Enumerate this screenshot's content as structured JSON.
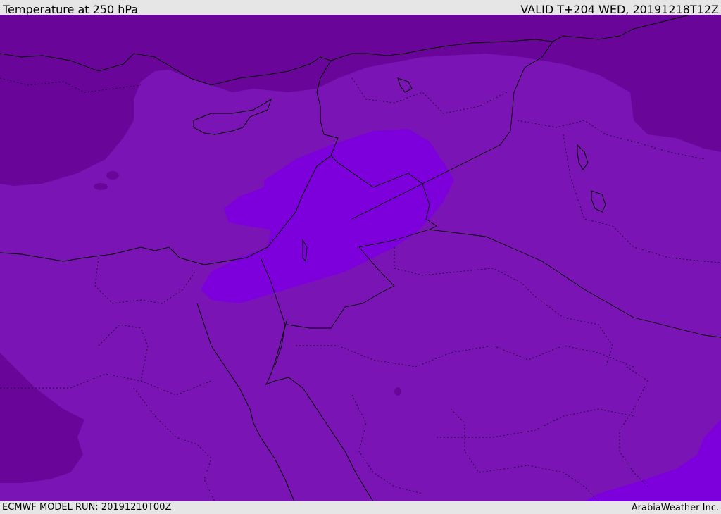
{
  "header": {
    "title": "Temperature at 250 hPa",
    "valid": "VALID T+204 WED, 20191218T12Z"
  },
  "footer": {
    "model_run": "ECMWF MODEL RUN: 20191210T00Z",
    "credit": "ArabiaWeather Inc."
  },
  "map": {
    "colors": {
      "background_band": "#7a14b4",
      "cold_band": "#6a0599",
      "warm_band": "#7d00dc",
      "coast_line": "#000000",
      "border_line": "#000000"
    }
  }
}
